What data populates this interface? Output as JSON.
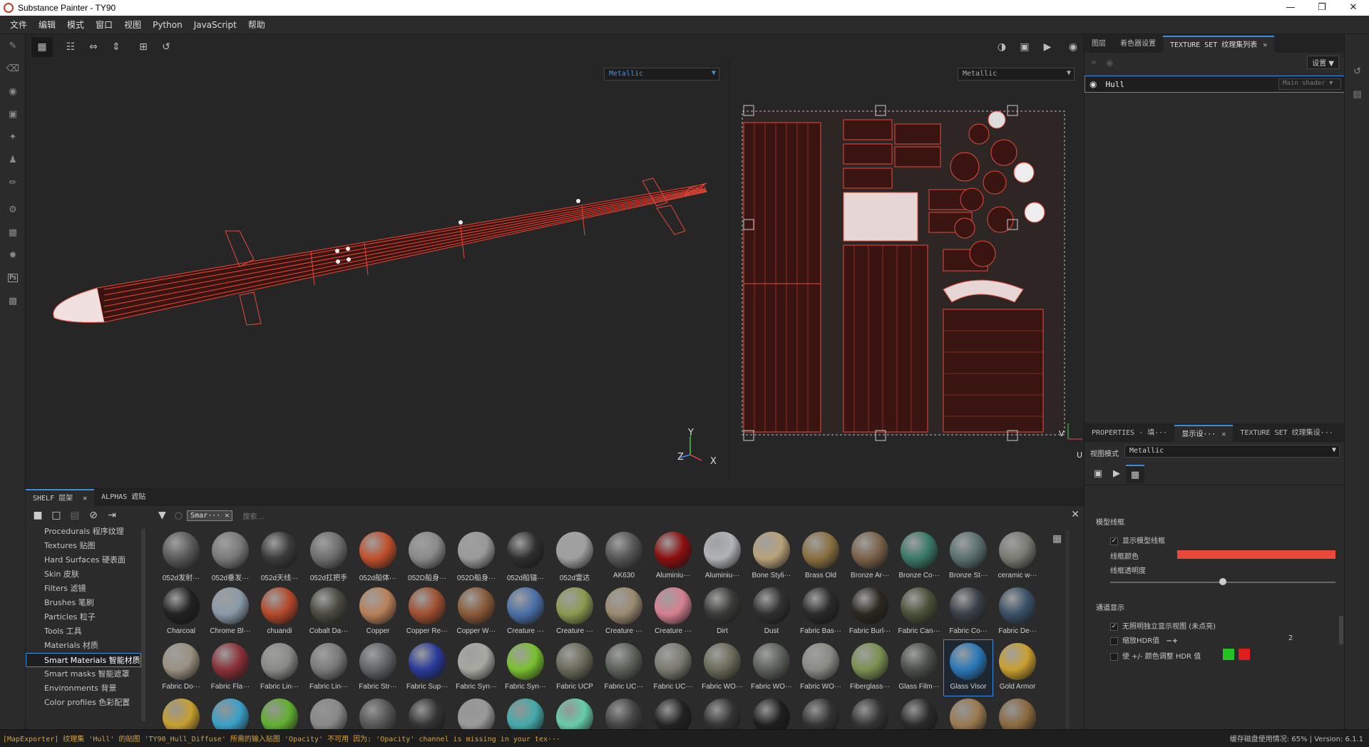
{
  "window": {
    "title": "Substance Painter - TY90"
  },
  "menu": [
    "文件",
    "编辑",
    "模式",
    "窗口",
    "视图",
    "Python",
    "JavaScript",
    "帮助"
  ],
  "viewport3d": {
    "channel": "Metallic",
    "axes": [
      "Y",
      "Z",
      "X"
    ]
  },
  "viewport2d": {
    "channel": "Metallic",
    "axis_u": "U",
    "axis_v": "V"
  },
  "right_top": {
    "tabs": [
      {
        "label": "图层"
      },
      {
        "label": "着色器设置"
      },
      {
        "label": "TEXTURE SET 纹理集列表"
      }
    ],
    "settings_label": "设置",
    "texture_set": {
      "name": "Hull",
      "shader": "Main shader"
    }
  },
  "right_bottom": {
    "tabs": [
      {
        "label": "PROPERTIES - 填···"
      },
      {
        "label": "显示设···"
      },
      {
        "label": "TEXTURE SET 纹理集设···"
      }
    ],
    "view_mode_label": "视图模式",
    "view_mode_value": "Metallic",
    "wireframe_section": "模型线框",
    "show_wireframe": "显示模型线框",
    "wireframe_color_label": "线框颜色",
    "wireframe_color": "#e8493a",
    "wireframe_opacity_label": "线框透明度",
    "wireframe_opacity": 0.5,
    "channel_section": "通道显示",
    "isolate_label": "无照明独立显示视图 (未点亮)",
    "hdr_label": "缩放HDR值",
    "hdr_value": "2",
    "color_adjust_label": "使 +/- 颜色调整 HDR 值",
    "color_plus": "#22c322",
    "color_minus": "#e01d1d"
  },
  "shelf": {
    "tabs": [
      {
        "label": "SHELF 层架"
      },
      {
        "label": "ALPHAS 遮贴"
      }
    ],
    "filter_tag": "Smar···",
    "search_placeholder": "搜索...",
    "categories": [
      "Procedurals 程序纹理",
      "Textures 贴图",
      "Hard Surfaces 硬表面",
      "Skin 皮肤",
      "Filters 滤镜",
      "Brushes 笔刷",
      "Particles 粒子",
      "Tools 工具",
      "Materials 材质",
      "Smart Materials 智能材质",
      "Smart masks 智能遮罩",
      "Environments 背景",
      "Color profiles 色彩配置"
    ],
    "active_category": "Smart Materials 智能材质",
    "materials_row1": [
      {
        "name": "052d发射···",
        "color": "#5a5a5a"
      },
      {
        "name": "052d垂发···",
        "color": "#7a7a7a"
      },
      {
        "name": "052d天线···",
        "color": "#3a3a3a"
      },
      {
        "name": "052d扛把手",
        "color": "#6e6e6e"
      },
      {
        "name": "052d船体···",
        "color": "#c0502c"
      },
      {
        "name": "052D船身···",
        "color": "#8a8a8a"
      },
      {
        "name": "052D船身···",
        "color": "#9a9a9a"
      },
      {
        "name": "052d船锚···",
        "color": "#2e2e2e"
      },
      {
        "name": "052d雷达",
        "color": "#a0a0a0"
      },
      {
        "name": "AK630",
        "color": "#555555"
      },
      {
        "name": "Aluminiu···",
        "color": "#8b1010"
      },
      {
        "name": "Aluminiu···",
        "color": "#b0b4b8"
      },
      {
        "name": "Bone Styli···",
        "color": "#b7a27a"
      },
      {
        "name": "Brass Old",
        "color": "#8a7040"
      },
      {
        "name": "Bronze Ar···",
        "color": "#7a6248"
      },
      {
        "name": "Bronze Co···",
        "color": "#3a7a68"
      },
      {
        "name": "Bronze St···",
        "color": "#5a7070"
      },
      {
        "name": "ceramic w···",
        "color": "#7a7a72"
      }
    ],
    "materials_row2": [
      {
        "name": "Charcoal",
        "color": "#222222"
      },
      {
        "name": "Chrome Bl···",
        "color": "#8a9aa8"
      },
      {
        "name": "chuandi",
        "color": "#b4482a"
      },
      {
        "name": "Cobalt Da···",
        "color": "#4a4a40"
      },
      {
        "name": "Copper",
        "color": "#b88058"
      },
      {
        "name": "Copper Re···",
        "color": "#a05030"
      },
      {
        "name": "Copper W···",
        "color": "#8a5a38"
      },
      {
        "name": "Creature ···",
        "color": "#4a70a8"
      },
      {
        "name": "Creature ···",
        "color": "#8a9a50"
      },
      {
        "name": "Creature ···",
        "color": "#9a8a70"
      },
      {
        "name": "Creature ···",
        "color": "#d48090"
      },
      {
        "name": "Dirt",
        "color": "#3a3a38"
      },
      {
        "name": "Dust",
        "color": "#303030"
      },
      {
        "name": "Fabric Bas···",
        "color": "#2a2a2a"
      },
      {
        "name": "Fabric Burl···",
        "color": "#2c2820"
      },
      {
        "name": "Fabric Can···",
        "color": "#4a5038"
      },
      {
        "name": "Fabric Co···",
        "color": "#3a4048"
      },
      {
        "name": "Fabric De···",
        "color": "#3a5068"
      }
    ],
    "materials_row3": [
      {
        "name": "Fabric Do···",
        "color": "#9a9080"
      },
      {
        "name": "Fabric Fla···",
        "color": "#8a3038"
      },
      {
        "name": "Fabric Lin···",
        "color": "#8a8a88"
      },
      {
        "name": "Fabric Lin···",
        "color": "#7a7a7a"
      },
      {
        "name": "Fabric Str···",
        "color": "#606468"
      },
      {
        "name": "Fabric Sup···",
        "color": "#2a3a9a"
      },
      {
        "name": "Fabric Syn···",
        "color": "#a8a8a0"
      },
      {
        "name": "Fabric Syn···",
        "color": "#7ac030"
      },
      {
        "name": "Fabric UCP",
        "color": "#6a6a5a"
      },
      {
        "name": "Fabric UC···",
        "color": "#5a6258"
      },
      {
        "name": "Fabric UC···",
        "color": "#7a7a70"
      },
      {
        "name": "Fabric WO···",
        "color": "#6a6a58"
      },
      {
        "name": "Fabric WO···",
        "color": "#5a6058"
      },
      {
        "name": "Fabric WO···",
        "color": "#8a8a84"
      },
      {
        "name": "Fiberglass···",
        "color": "#7a9050"
      },
      {
        "name": "Glass Film···",
        "color": "#4a5048"
      },
      {
        "name": "Glass Visor",
        "color": "#2a78b8"
      },
      {
        "name": "Gold Armor",
        "color": "#c8a030"
      }
    ],
    "selected_material": "Glass Visor"
  },
  "status": {
    "message": "[MapExporter] 纹理集 'Hull' 的贴图 'TY90_Hull_Diffuse' 所需的输入贴图 'Opacity' 不可用 因为: 'Opacity' channel is missing in your tex···",
    "cache": "缓存磁盘使用情况: 65% | Version: 6.1.1"
  }
}
